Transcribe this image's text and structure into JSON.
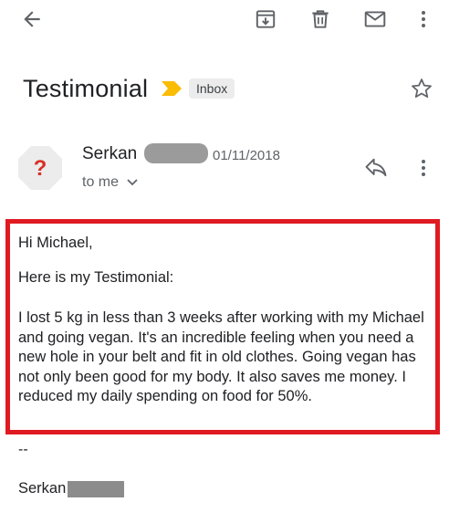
{
  "toolbar": {
    "back_icon": "arrow-back-icon",
    "archive_icon": "archive-icon",
    "delete_icon": "trash-icon",
    "mark_unread_icon": "mail-icon",
    "more_icon": "more-vert-icon"
  },
  "email": {
    "subject": "Testimonial",
    "label": "Inbox",
    "importance_color": "#fbbc04",
    "sender": {
      "name": "Serkan",
      "date": "01/11/2018",
      "recipients": "to me",
      "avatar_glyph": "?",
      "avatar_color": "#d93025"
    },
    "body": {
      "greeting": "Hi Michael,",
      "intro": "Here is my Testimonial:",
      "text": "I lost 5 kg in less than 3 weeks after working with my Michael and going vegan. It's an incredible feeling when you need a new hole in your belt and fit in old clothes. Going vegan has not only been good for my body. It also saves me money. I reduced my daily spending on food for 50%."
    },
    "signature": {
      "separator": "--",
      "name": "Serkan"
    }
  },
  "colors": {
    "highlight_border": "#e01a22",
    "redaction": "#8a8a8a"
  }
}
